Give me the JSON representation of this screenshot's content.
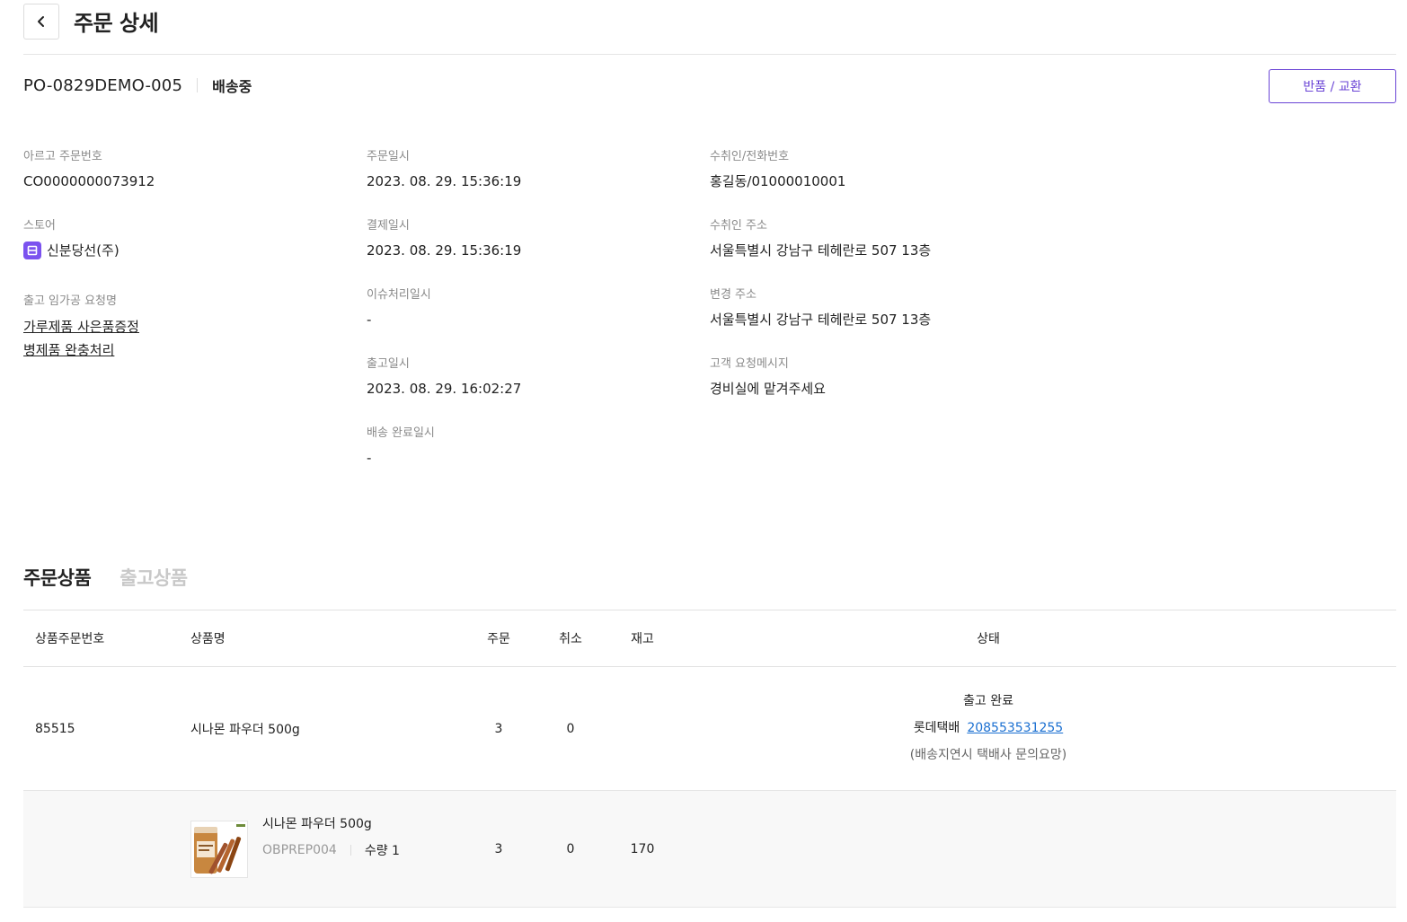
{
  "header": {
    "title": "주문 상세"
  },
  "order": {
    "number": "PO-0829DEMO-005",
    "status": "배송중"
  },
  "actions": {
    "return_exchange": "반품 / 교환"
  },
  "col1": {
    "argo_order_no": {
      "label": "아르고 주문번호",
      "value": "CO0000000073912"
    },
    "store": {
      "label": "스토어",
      "value": "신분당선(주)"
    },
    "processing": {
      "label": "출고 임가공 요청명",
      "items": [
        "가루제품 사은품증정",
        "병제품 완충처리"
      ]
    }
  },
  "col2": {
    "order_date": {
      "label": "주문일시",
      "value": "2023. 08. 29. 15:36:19"
    },
    "payment_date": {
      "label": "결제일시",
      "value": "2023. 08. 29. 15:36:19"
    },
    "issue_date": {
      "label": "이슈처리일시",
      "value": "-"
    },
    "shipped_date": {
      "label": "출고일시",
      "value": "2023. 08. 29. 16:02:27"
    },
    "delivered_date": {
      "label": "배송 완료일시",
      "value": "-"
    }
  },
  "col3": {
    "recipient": {
      "label": "수취인/전화번호",
      "value": "홍길동/01000010001"
    },
    "address": {
      "label": "수취인 주소",
      "value": "서울특별시 강남구 테헤란로 507 13층"
    },
    "changed_address": {
      "label": "변경 주소",
      "value": "서울특별시 강남구 테헤란로 507 13층"
    },
    "customer_message": {
      "label": "고객 요청메시지",
      "value": "경비실에 맡겨주세요"
    }
  },
  "tabs": [
    "주문상품",
    "출고상품"
  ],
  "table": {
    "headers": {
      "no": "상품주문번호",
      "name": "상품명",
      "order": "주문",
      "cancel": "취소",
      "stock": "재고",
      "status": "상태"
    },
    "rows": [
      {
        "no": "85515",
        "name": "시나몬 파우더 500g",
        "order": "3",
        "cancel": "0",
        "status": "출고 완료",
        "carrier": "롯데택배",
        "tracking": "208553531255",
        "note": "(배송지연시 택배사 문의요망)"
      }
    ],
    "items": [
      {
        "name": "시나몬 파우더 500g",
        "sku": "OBPREP004",
        "qty": "수량 1",
        "order": "3",
        "cancel": "0",
        "stock": "170"
      }
    ]
  }
}
